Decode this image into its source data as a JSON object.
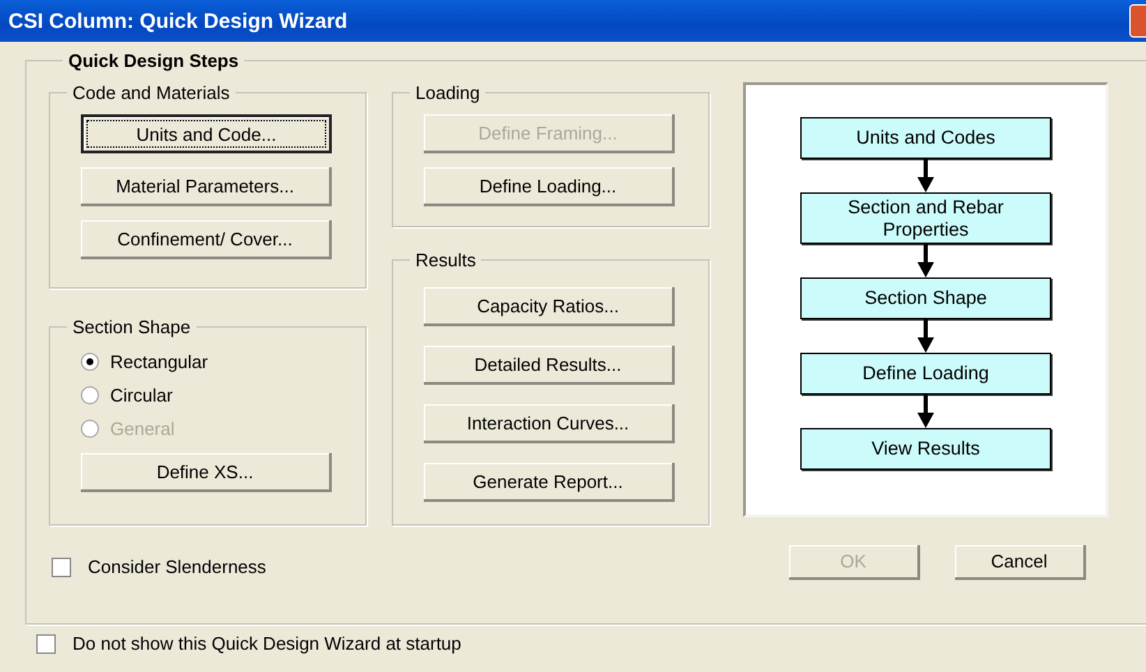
{
  "window": {
    "title": "CSI Column: Quick Design Wizard"
  },
  "steps_group": {
    "title": "Quick Design Steps"
  },
  "code_and_materials": {
    "title": "Code and Materials",
    "buttons": [
      {
        "label": "Units and Code...",
        "focused": true,
        "disabled": false
      },
      {
        "label": "Material Parameters...",
        "focused": false,
        "disabled": false
      },
      {
        "label": "Confinement/ Cover...",
        "focused": false,
        "disabled": false
      }
    ]
  },
  "section_shape": {
    "title": "Section Shape",
    "options": [
      {
        "label": "Rectangular",
        "selected": true,
        "disabled": false
      },
      {
        "label": "Circular",
        "selected": false,
        "disabled": false
      },
      {
        "label": "General",
        "selected": false,
        "disabled": true
      }
    ],
    "button": {
      "label": "Define XS...",
      "focused": false,
      "disabled": false
    }
  },
  "loading": {
    "title": "Loading",
    "buttons": [
      {
        "label": "Define Framing...",
        "focused": false,
        "disabled": true
      },
      {
        "label": "Define Loading...",
        "focused": false,
        "disabled": false
      }
    ]
  },
  "results": {
    "title": "Results",
    "buttons": [
      {
        "label": "Capacity Ratios...",
        "focused": false,
        "disabled": false
      },
      {
        "label": "Detailed Results...",
        "focused": false,
        "disabled": false
      },
      {
        "label": "Interaction Curves...",
        "focused": false,
        "disabled": false
      },
      {
        "label": "Generate Report...",
        "focused": false,
        "disabled": false
      }
    ]
  },
  "flowchart": {
    "steps": [
      {
        "label": "Units and Codes"
      },
      {
        "label": "Section and Rebar Properties"
      },
      {
        "label": "Section Shape"
      },
      {
        "label": "Define Loading"
      },
      {
        "label": "View Results"
      }
    ]
  },
  "consider_slenderness": {
    "label": "Consider Slenderness",
    "checked": false
  },
  "dialog_buttons": [
    {
      "label": "OK",
      "disabled": true
    },
    {
      "label": "Cancel",
      "disabled": false
    }
  ],
  "startup_checkbox": {
    "label": "Do not show this Quick Design Wizard at startup",
    "checked": false
  }
}
